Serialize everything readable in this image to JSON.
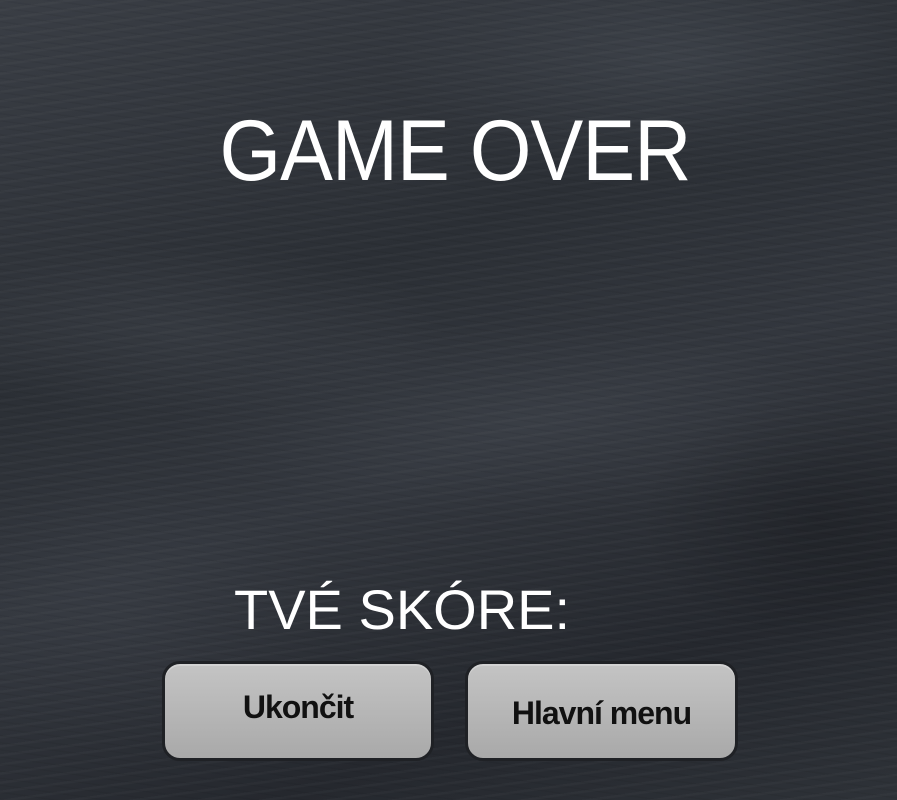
{
  "game_over": {
    "title": "GAME OVER",
    "score_label": "TVÉ SKÓRE:",
    "score_value": ""
  },
  "buttons": {
    "quit_label": "Ukončit",
    "main_menu_label": "Hlavní menu"
  },
  "colors": {
    "background": "#2e3238",
    "text": "#ffffff",
    "button_fill": "#b8b8b8",
    "button_border": "#1f2125",
    "button_text": "#111111"
  }
}
